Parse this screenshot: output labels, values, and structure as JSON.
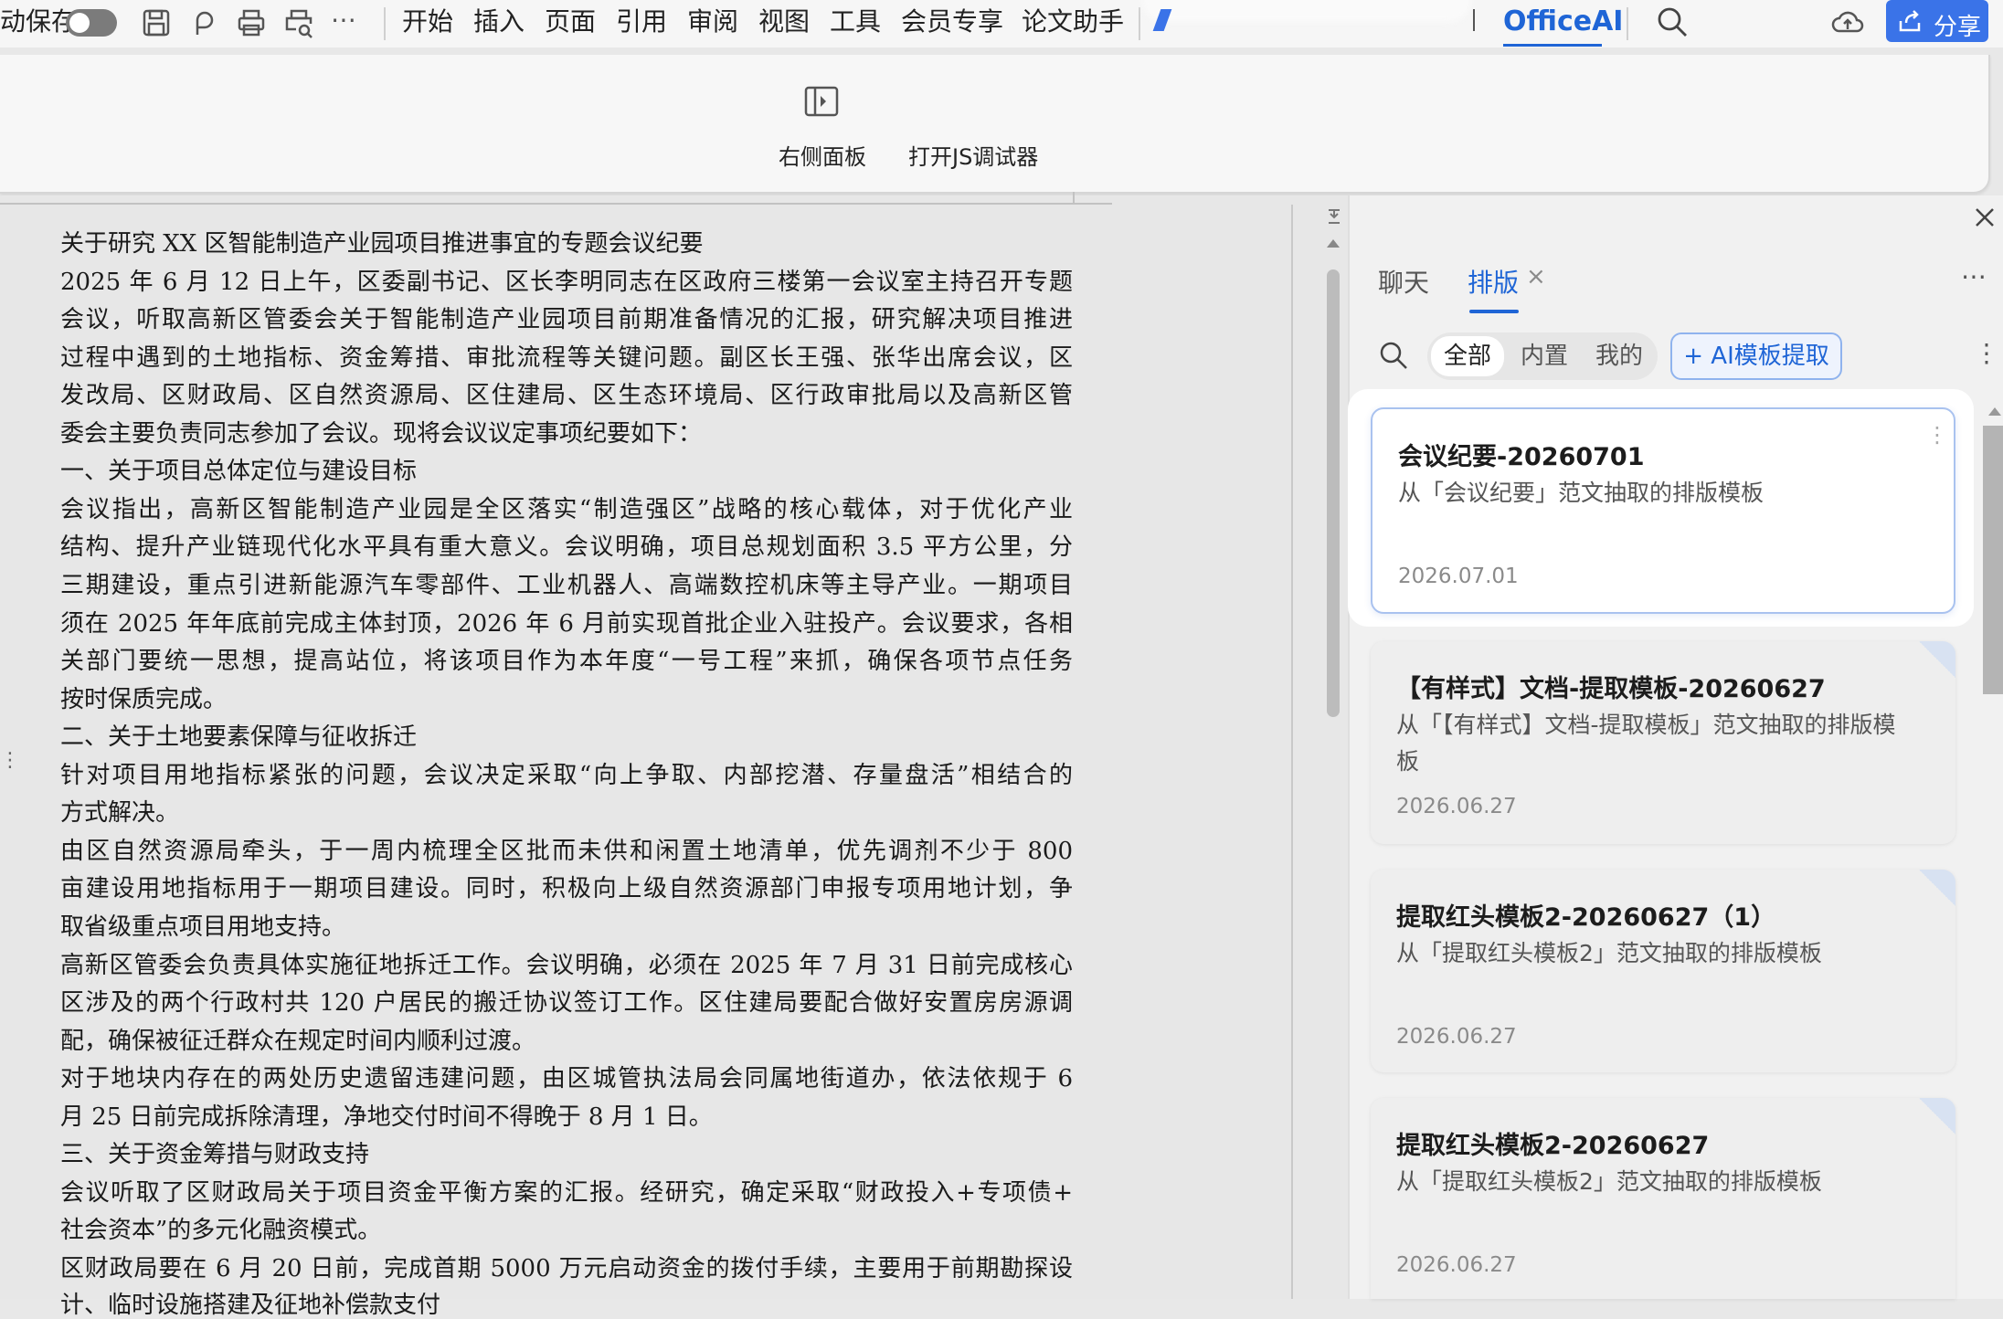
{
  "topbar": {
    "autosave_label": "动保存",
    "menu": [
      "开始",
      "插入",
      "页面",
      "引用",
      "审阅",
      "视图",
      "工具",
      "会员专享",
      "论文助手"
    ],
    "officeai_label": "OfficeAI",
    "share_label": "分享"
  },
  "ribbon": {
    "right_panel_label": "右侧面板",
    "js_debugger_label": "打开JS调试器"
  },
  "document": {
    "lines": [
      "关于研究 XX 区智能制造产业园项目推进事宜的专题会议纪要",
      "2025 年 6 月 12 日上午，区委副书记、区长李明同志在区政府三楼第一会议室主持召开专题",
      "会议，听取高新区管委会关于智能制造产业园项目前期准备情况的汇报，研究解决项目推进",
      "过程中遇到的土地指标、资金筹措、审批流程等关键问题。副区长王强、张华出席会议，区",
      "发改局、区财政局、区自然资源局、区住建局、区生态环境局、区行政审批局以及高新区管",
      "委会主要负责同志参加了会议。现将会议议定事项纪要如下：",
      "一、关于项目总体定位与建设目标",
      "会议指出，高新区智能制造产业园是全区落实“制造强区”战略的核心载体，对于优化产业",
      "结构、提升产业链现代化水平具有重大意义。会议明确，项目总规划面积 3.5 平方公里，分",
      "三期建设，重点引进新能源汽车零部件、工业机器人、高端数控机床等主导产业。一期项目",
      "须在 2025 年年底前完成主体封顶，2026 年 6 月前实现首批企业入驻投产。会议要求，各相",
      "关部门要统一思想，提高站位，将该项目作为本年度“一号工程”来抓，确保各项节点任务",
      "按时保质完成。",
      "二、关于土地要素保障与征收拆迁",
      "针对项目用地指标紧张的问题，会议决定采取“向上争取、内部挖潜、存量盘活”相结合的",
      "方式解决。",
      "由区自然资源局牵头，于一周内梳理全区批而未供和闲置土地清单，优先调剂不少于 800",
      "亩建设用地指标用于一期项目建设。同时，积极向上级自然资源部门申报专项用地计划，争",
      "取省级重点项目用地支持。",
      "高新区管委会负责具体实施征地拆迁工作。会议明确，必须在 2025 年 7 月 31 日前完成核心",
      "区涉及的两个行政村共 120 户居民的搬迁协议签订工作。区住建局要配合做好安置房房源调",
      "配，确保被征迁群众在规定时间内顺利过渡。",
      "对于地块内存在的两处历史遗留违建问题，由区城管执法局会同属地街道办，依法依规于 6",
      "月 25 日前完成拆除清理，净地交付时间不得晚于 8 月 1 日。",
      "三、关于资金筹措与财政支持",
      "会议听取了区财政局关于项目资金平衡方案的汇报。经研究，确定采取“财政投入+专项债+",
      "社会资本”的多元化融资模式。",
      "区财政局要在 6 月 20 日前，完成首期 5000 万元启动资金的拨付手续，主要用于前期勘探设",
      "计、临时设施搭建及征地补偿款支付"
    ]
  },
  "panel": {
    "tabs": [
      {
        "label": "聊天"
      },
      {
        "label": "排版"
      }
    ],
    "tab_close": "×",
    "filters": [
      "全部",
      "内置",
      "我的"
    ],
    "ai_button_label": "+ AI模板提取",
    "cards": [
      {
        "title": "会议纪要-20260701",
        "desc": "从「会议纪要」范文抽取的排版模板",
        "date": "2026.07.01"
      },
      {
        "title": "【有样式】文档-提取模板-20260627",
        "desc": "从「【有样式】文档-提取模板」范文抽取的排版模板",
        "date": "2026.06.27"
      },
      {
        "title": "提取红头模板2-20260627（1）",
        "desc": "从「提取红头模板2」范文抽取的排版模板",
        "date": "2026.06.27"
      },
      {
        "title": "提取红头模板2-20260627",
        "desc": "从「提取红头模板2」范文抽取的排版模板",
        "date": "2026.06.27"
      }
    ]
  },
  "colors": {
    "accent": "#1f65d6",
    "share_bg": "#3a73e8"
  }
}
